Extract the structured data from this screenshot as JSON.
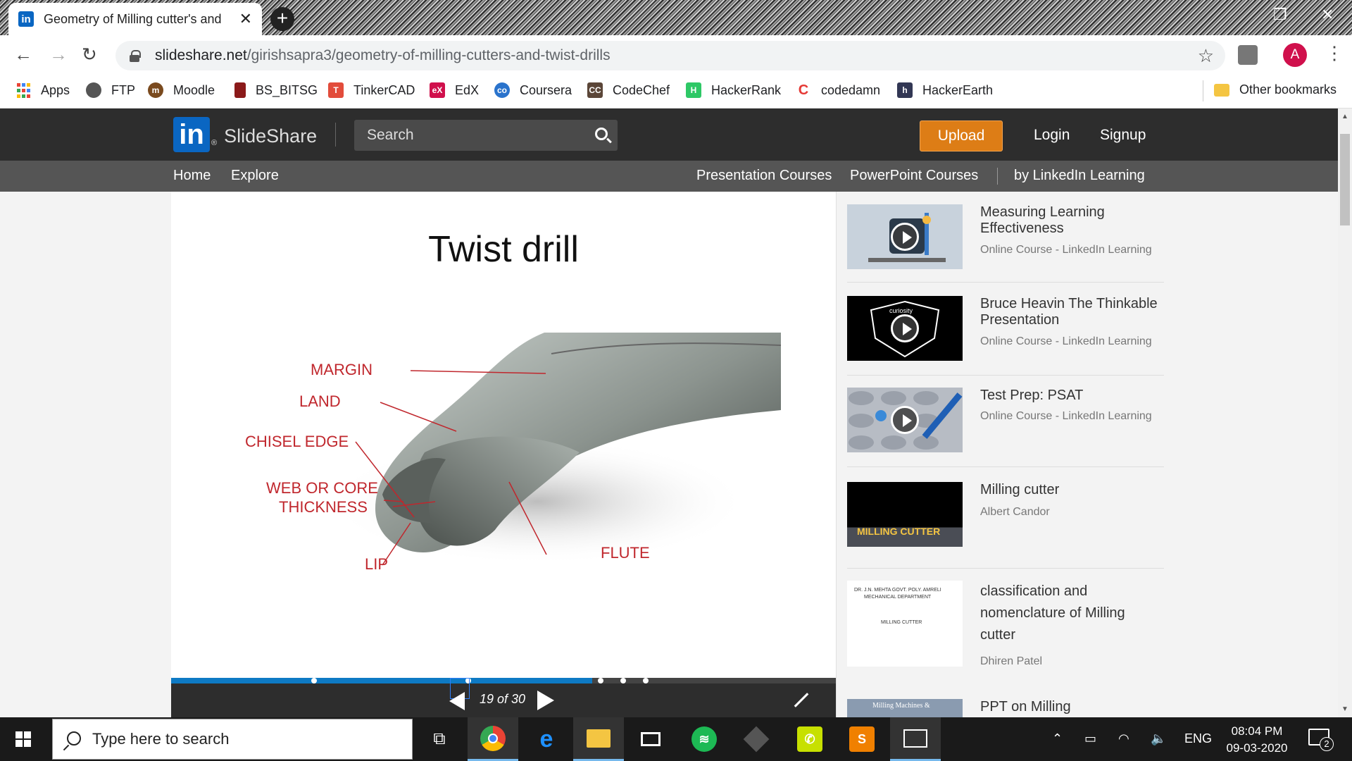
{
  "browser": {
    "tab_title": "Geometry of Milling cutter's and",
    "url_domain": "slideshare.net",
    "url_path": "/girishsapra3/geometry-of-milling-cutters-and-twist-drills",
    "avatar_letter": "A"
  },
  "bookmarks": [
    {
      "label": "Apps",
      "icon": "apps-grid-icon",
      "color": "#ea4335"
    },
    {
      "label": "FTP",
      "icon": "globe-icon",
      "color": "#555555"
    },
    {
      "label": "Moodle",
      "icon": "moodle-icon",
      "color": "#7a4a1e"
    },
    {
      "label": "BS_BITSG",
      "icon": "document-icon",
      "color": "#8b1a1a"
    },
    {
      "label": "TinkerCAD",
      "icon": "tinkercad-icon",
      "color": "#e24c3b"
    },
    {
      "label": "EdX",
      "icon": "edx-icon",
      "color": "#d0104c"
    },
    {
      "label": "Coursera",
      "icon": "coursera-icon",
      "color": "#2a73cc"
    },
    {
      "label": "CodeChef",
      "icon": "codechef-icon",
      "color": "#5b4638"
    },
    {
      "label": "HackerRank",
      "icon": "hackerrank-icon",
      "color": "#2ec866"
    },
    {
      "label": "codedamn",
      "icon": "codedamn-icon",
      "color": "#e53935"
    },
    {
      "label": "HackerEarth",
      "icon": "hackerearth-icon",
      "color": "#323754"
    },
    {
      "label": "Other bookmarks",
      "icon": "folder-icon",
      "color": "#f4c542"
    }
  ],
  "slideshare": {
    "brand": "SlideShare",
    "search_placeholder": "Search",
    "upload": "Upload",
    "login": "Login",
    "signup": "Signup",
    "nav_left": [
      "Home",
      "Explore"
    ],
    "nav_right": [
      "Presentation Courses",
      "PowerPoint Courses",
      "by LinkedIn Learning"
    ]
  },
  "slide": {
    "title": "Twist drill",
    "labels": [
      "MARGIN",
      "LAND",
      "CHISEL EDGE",
      "WEB OR CORE",
      "THICKNESS",
      "LIP",
      "FLUTE"
    ],
    "counter": "19 of 30",
    "progress_fraction": 0.633
  },
  "related": [
    {
      "title": "Measuring Learning Effectiveness",
      "sub": "Online Course - LinkedIn Learning",
      "video": true
    },
    {
      "title": "Bruce Heavin The Thinkable Presentation",
      "sub": "Online Course - LinkedIn Learning",
      "video": true
    },
    {
      "title": "Test Prep: PSAT",
      "sub": "Online Course - LinkedIn Learning",
      "video": true
    },
    {
      "title": "Milling cutter",
      "sub": "Albert Candor",
      "thumb_text": "MILLING CUTTER"
    },
    {
      "title": "classification and nomenclature of Milling cutter",
      "sub": "Dhiren Patel",
      "thumb_lines": [
        "DR. J.N. MEHTA GOVT. POLY. AMRELI",
        "MECHANICAL DEPARTMENT",
        "MILLING CUTTER"
      ]
    },
    {
      "title": "PPT on Milling",
      "sub": "",
      "thumb_text": "Milling Machines &"
    }
  ],
  "taskbar": {
    "search_placeholder": "Type here to search",
    "lang": "ENG",
    "time": "08:04 PM",
    "date": "09-03-2020",
    "notifications": "2"
  }
}
